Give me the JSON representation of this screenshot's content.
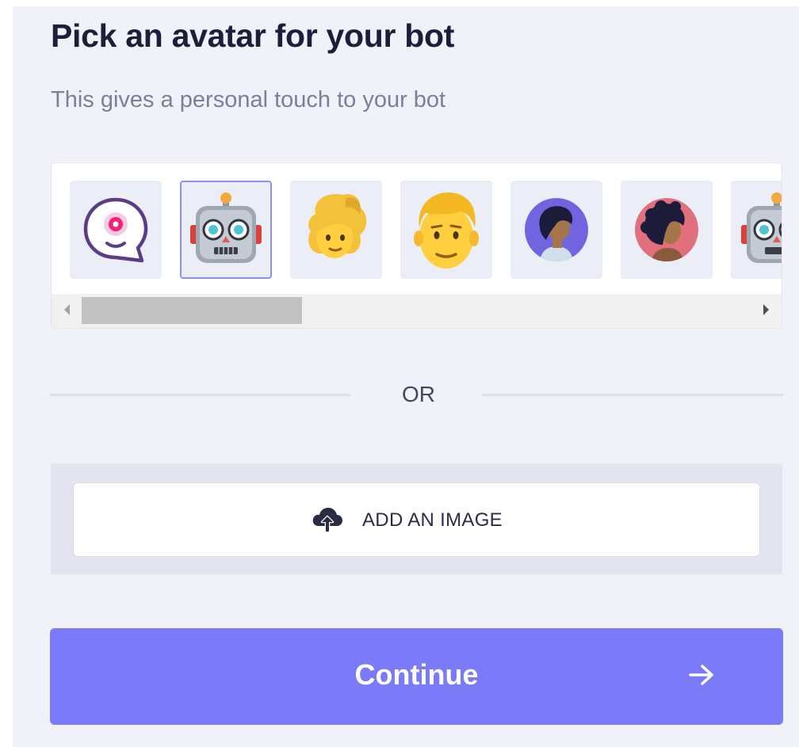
{
  "header": {
    "title": "Pick an avatar for your bot",
    "subtitle": "This gives a personal touch to your bot"
  },
  "avatars": [
    {
      "icon": "speech-bubble-eye-icon",
      "selected": false
    },
    {
      "icon": "robot-face-icon",
      "selected": true
    },
    {
      "icon": "woman-blond-icon",
      "selected": false
    },
    {
      "icon": "man-blond-icon",
      "selected": false
    },
    {
      "icon": "person-purple-circle-icon",
      "selected": false
    },
    {
      "icon": "person-pink-circle-icon",
      "selected": false
    },
    {
      "icon": "robot-face-icon",
      "selected": false
    }
  ],
  "divider": {
    "label": "OR"
  },
  "upload": {
    "label": "ADD AN IMAGE",
    "icon": "cloud-upload-icon"
  },
  "continue_button": {
    "label": "Continue",
    "icon": "arrow-right-icon"
  },
  "colors": {
    "accent": "#7b7af8",
    "title": "#1d1e3a",
    "subtitle": "#7d7f96",
    "background": "#f0f1f9"
  }
}
